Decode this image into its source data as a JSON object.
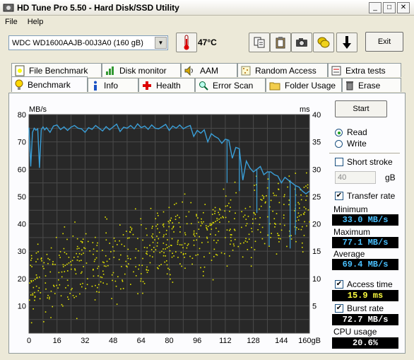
{
  "window": {
    "title": "HD Tune Pro 5.50 - Hard Disk/SSD Utility"
  },
  "menu": [
    "File",
    "Help"
  ],
  "toolbar": {
    "drive": "WDC WD1600AAJB-00J3A0 (160 gB)",
    "temperature": "47°C",
    "exit_label": "Exit"
  },
  "tabs_top": [
    "File Benchmark",
    "Disk monitor",
    "AAM",
    "Random Access",
    "Extra tests"
  ],
  "tabs_bottom": [
    "Benchmark",
    "Info",
    "Health",
    "Error Scan",
    "Folder Usage",
    "Erase"
  ],
  "controls": {
    "start_label": "Start",
    "read_label": "Read",
    "write_label": "Write",
    "short_stroke_label": "Short stroke",
    "short_stroke_value": "40",
    "short_stroke_unit": "gB",
    "transfer_rate_label": "Transfer rate",
    "minimum_label": "Minimum",
    "minimum_value": "33.0 MB/s",
    "maximum_label": "Maximum",
    "maximum_value": "77.1 MB/s",
    "average_label": "Average",
    "average_value": "69.4 MB/s",
    "access_time_label": "Access time",
    "access_time_value": "15.9 ms",
    "burst_rate_label": "Burst rate",
    "burst_rate_value": "72.7 MB/s",
    "cpu_label": "CPU usage",
    "cpu_value": "20.6%"
  },
  "colors": {
    "transfer": "#3a9fd8",
    "access": "#e6e600",
    "value_text_blue": "#49c0ff",
    "value_text_yellow": "#ffff40"
  },
  "chart_data": {
    "type": "line",
    "ylabel_left": "MB/s",
    "ylabel_right": "ms",
    "xlabel_unit": "gB",
    "x_ticks": [
      "0",
      "16",
      "32",
      "48",
      "64",
      "80",
      "96",
      "112",
      "128",
      "144",
      "160gB"
    ],
    "y_left_ticks": [
      "10",
      "20",
      "30",
      "40",
      "50",
      "60",
      "70",
      "80"
    ],
    "y_right_ticks": [
      "5",
      "10",
      "15",
      "20",
      "25",
      "30",
      "35",
      "40"
    ],
    "xlim": [
      0,
      160
    ],
    "ylim_left": [
      0,
      80
    ],
    "ylim_right": [
      0,
      40
    ],
    "series": [
      {
        "axis": "left",
        "x": [
          0,
          1,
          2,
          3,
          4,
          5,
          6,
          7,
          8,
          9,
          10,
          12,
          14,
          16,
          18,
          20,
          22,
          24,
          26,
          28,
          30,
          32,
          34,
          36,
          38,
          40,
          42,
          44,
          46,
          48,
          50,
          52,
          54,
          56,
          58,
          60,
          62,
          64,
          66,
          68,
          70,
          72,
          74,
          76,
          78,
          80,
          82,
          84,
          86,
          88,
          90,
          92,
          94,
          96,
          98,
          100,
          102,
          104,
          106,
          108,
          110,
          112,
          114,
          116,
          118,
          120,
          122,
          124,
          126,
          128,
          130,
          132,
          134,
          136,
          138,
          140,
          142,
          144,
          146,
          148,
          150,
          152,
          154,
          156,
          158,
          160
        ],
        "y": [
          75.2,
          61,
          73.5,
          75,
          74.3,
          74.8,
          60.5,
          74.5,
          75.5,
          74.4,
          75.2,
          73.5,
          75.8,
          76.2,
          74.5,
          75.5,
          74.2,
          75.4,
          76,
          75,
          74.8,
          73.5,
          75.2,
          74.6,
          76,
          75,
          74,
          75.6,
          74.4,
          75.5,
          76.5,
          73.8,
          75.4,
          75,
          76,
          74.8,
          76.6,
          75.2,
          75.8,
          74.6,
          76.2,
          75,
          74.8,
          75.6,
          76.4,
          74.2,
          75.8,
          75,
          76.2,
          74.8,
          75.5,
          76,
          72,
          74.2,
          73.2,
          74.4,
          70,
          73,
          72,
          71.3,
          69.5,
          71,
          70.6,
          64,
          68,
          67.5,
          56,
          63,
          60.5,
          59,
          60,
          61,
          58,
          59,
          59,
          58,
          57.5,
          55,
          57,
          56,
          55,
          54,
          53.5,
          52,
          51,
          52
        ]
      }
    ],
    "access_points": "seeded scatter ~ rising from 15ms at 0gB to 25ms at 160gB"
  }
}
